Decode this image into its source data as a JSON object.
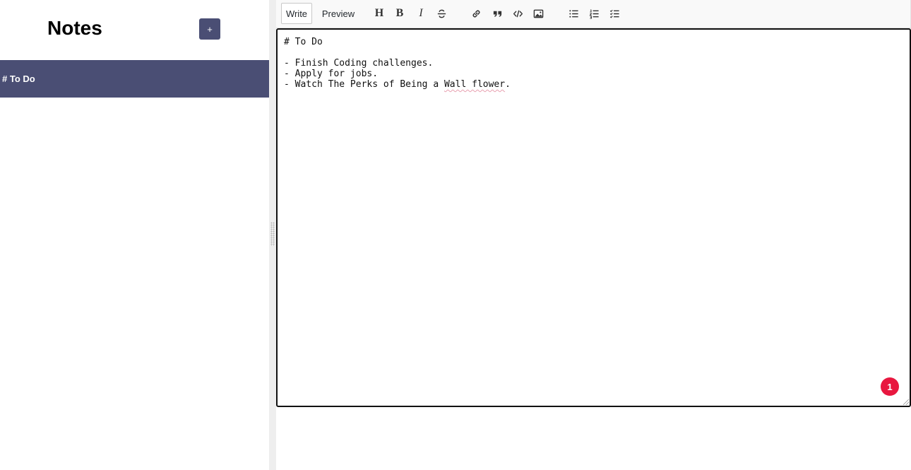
{
  "sidebar": {
    "title": "Notes",
    "add_label": "+",
    "notes": [
      {
        "label": "# To Do",
        "selected": true
      }
    ]
  },
  "editor": {
    "tabs": {
      "write": "Write",
      "preview": "Preview"
    },
    "active_tab": "Write",
    "toolbar": {
      "heading": "H",
      "bold": "B",
      "italic": "I",
      "icons": [
        "heading-icon",
        "bold-icon",
        "italic-icon",
        "strikethrough-icon",
        "link-icon",
        "quote-icon",
        "code-icon",
        "image-icon",
        "unordered-list-icon",
        "ordered-list-icon",
        "checked-list-icon"
      ]
    },
    "content": {
      "line1": "# To Do",
      "line2": "",
      "line3": "- Finish Coding challenges.",
      "line4": "- Apply for jobs.",
      "line5_prefix": "- Watch The Perks of Being a ",
      "line5_misspelled": "Wall flower",
      "line5_suffix": "."
    },
    "badge_count": "1"
  },
  "colors": {
    "accent": "#4a4e74",
    "badge": "#e8173f",
    "gutter": "#eeeeee"
  }
}
